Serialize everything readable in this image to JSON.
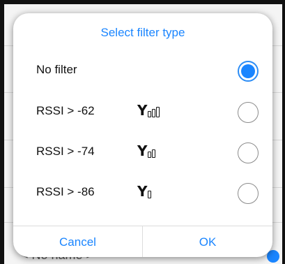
{
  "colors": {
    "accent": "#1a85ff",
    "text": "#111111"
  },
  "background": {
    "list_item_text": "< No name >"
  },
  "dialog": {
    "title": "Select filter type",
    "options": [
      {
        "label": "No filter",
        "signal_bars": 0,
        "selected": true
      },
      {
        "label": "RSSI > -62",
        "signal_bars": 3,
        "selected": false,
        "icon": "signal-strength-icon"
      },
      {
        "label": "RSSI > -74",
        "signal_bars": 2,
        "selected": false,
        "icon": "signal-strength-icon"
      },
      {
        "label": "RSSI > -86",
        "signal_bars": 1,
        "selected": false,
        "icon": "signal-strength-icon"
      }
    ],
    "cancel_label": "Cancel",
    "ok_label": "OK"
  }
}
